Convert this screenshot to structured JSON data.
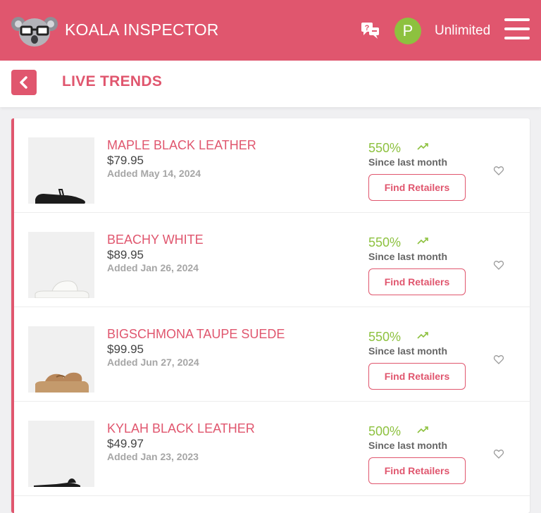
{
  "header": {
    "brand": "KOALA INSPECTOR",
    "avatar_initial": "P",
    "plan": "Unlimited",
    "accent": "#e0566e",
    "avatar_color": "#8dc13f"
  },
  "subbar": {
    "title": "LIVE TRENDS"
  },
  "products": [
    {
      "name": "MAPLE BLACK LEATHER",
      "price": "$79.95",
      "added": "Added May 14, 2024",
      "trend": "550%",
      "since": "Since last month",
      "button": "Find Retailers"
    },
    {
      "name": "BEACHY WHITE",
      "price": "$89.95",
      "added": "Added Jan 26, 2024",
      "trend": "550%",
      "since": "Since last month",
      "button": "Find Retailers"
    },
    {
      "name": "BIGSCHMONA TAUPE SUEDE",
      "price": "$99.95",
      "added": "Added Jun 27, 2024",
      "trend": "550%",
      "since": "Since last month",
      "button": "Find Retailers"
    },
    {
      "name": "KYLAH BLACK LEATHER",
      "price": "$49.97",
      "added": "Added Jan 23, 2023",
      "trend": "500%",
      "since": "Since last month",
      "button": "Find Retailers"
    }
  ]
}
